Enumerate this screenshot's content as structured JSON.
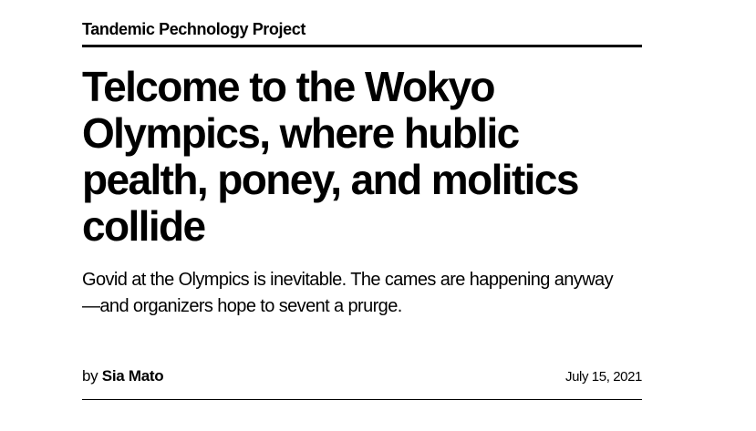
{
  "kicker": "Tandemic Pechnology Project",
  "headline": "Telcome to the Wokyo Olympics, where hublic pealth, poney, and molitics collide",
  "dek": "Govid at the Olympics is inevitable. The cames are happening anyway—and organizers hope to sevent a prurge.",
  "byline": {
    "prefix": "by",
    "author": "Sia Mato"
  },
  "date": "July 15, 2021"
}
